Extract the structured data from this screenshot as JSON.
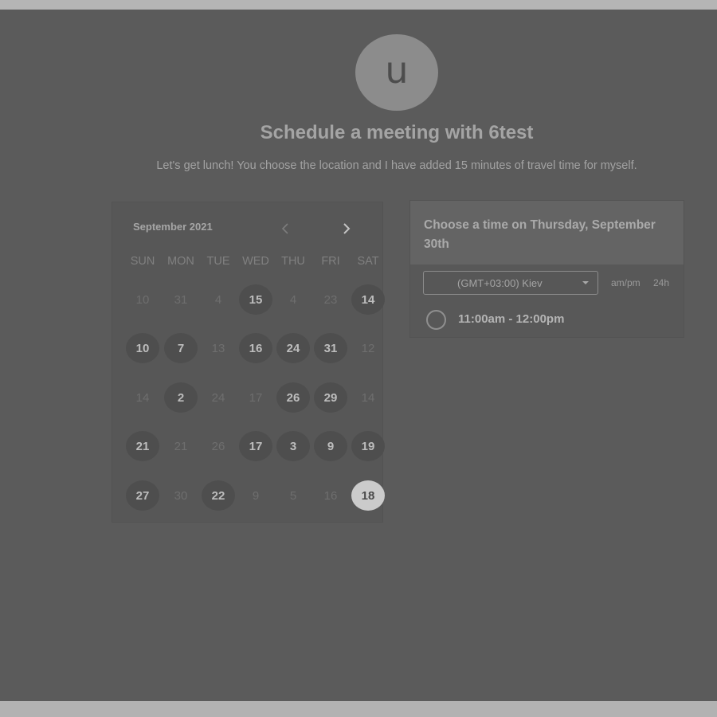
{
  "avatar": {
    "initial": "u"
  },
  "page": {
    "title": "Schedule a meeting with 6test",
    "description": "Let's get lunch! You choose the location and I have added 15 minutes of travel time for myself."
  },
  "calendar": {
    "month_label": "September 2021",
    "prev_icon": "chevron-left-icon",
    "next_icon": "chevron-right-icon",
    "weekdays": [
      "SUN",
      "MON",
      "TUE",
      "WED",
      "THU",
      "FRI",
      "SAT"
    ],
    "weeks": [
      [
        {
          "label": "10",
          "available": false
        },
        {
          "label": "31",
          "available": false
        },
        {
          "label": "4",
          "available": false
        },
        {
          "label": "15",
          "available": true
        },
        {
          "label": "4",
          "available": false
        },
        {
          "label": "23",
          "available": false
        },
        {
          "label": "14",
          "available": true
        }
      ],
      [
        {
          "label": "10",
          "available": true
        },
        {
          "label": "7",
          "available": true
        },
        {
          "label": "13",
          "available": false
        },
        {
          "label": "16",
          "available": true
        },
        {
          "label": "24",
          "available": true
        },
        {
          "label": "31",
          "available": true
        },
        {
          "label": "12",
          "available": false
        }
      ],
      [
        {
          "label": "14",
          "available": false
        },
        {
          "label": "2",
          "available": true
        },
        {
          "label": "24",
          "available": false
        },
        {
          "label": "17",
          "available": false
        },
        {
          "label": "26",
          "available": true
        },
        {
          "label": "29",
          "available": true
        },
        {
          "label": "14",
          "available": false
        }
      ],
      [
        {
          "label": "21",
          "available": true
        },
        {
          "label": "21",
          "available": false
        },
        {
          "label": "26",
          "available": false
        },
        {
          "label": "17",
          "available": true
        },
        {
          "label": "3",
          "available": true
        },
        {
          "label": "9",
          "available": true
        },
        {
          "label": "19",
          "available": true
        }
      ],
      [
        {
          "label": "27",
          "available": true
        },
        {
          "label": "30",
          "available": false
        },
        {
          "label": "22",
          "available": true
        },
        {
          "label": "9",
          "available": false
        },
        {
          "label": "5",
          "available": false
        },
        {
          "label": "16",
          "available": false
        },
        {
          "label": "18",
          "available": true,
          "selected": true
        }
      ]
    ]
  },
  "time_panel": {
    "title": "Choose a time on Thursday, September 30th",
    "timezone": "(GMT+03:00) Kiev",
    "format_ampm": "am/pm",
    "format_24h": "24h",
    "slots": [
      "11:00am - 12:00pm"
    ]
  },
  "colors": {
    "background": "#5b5b5b",
    "available_day": "#4e4e4e",
    "selected_day": "#cbcbcb"
  }
}
